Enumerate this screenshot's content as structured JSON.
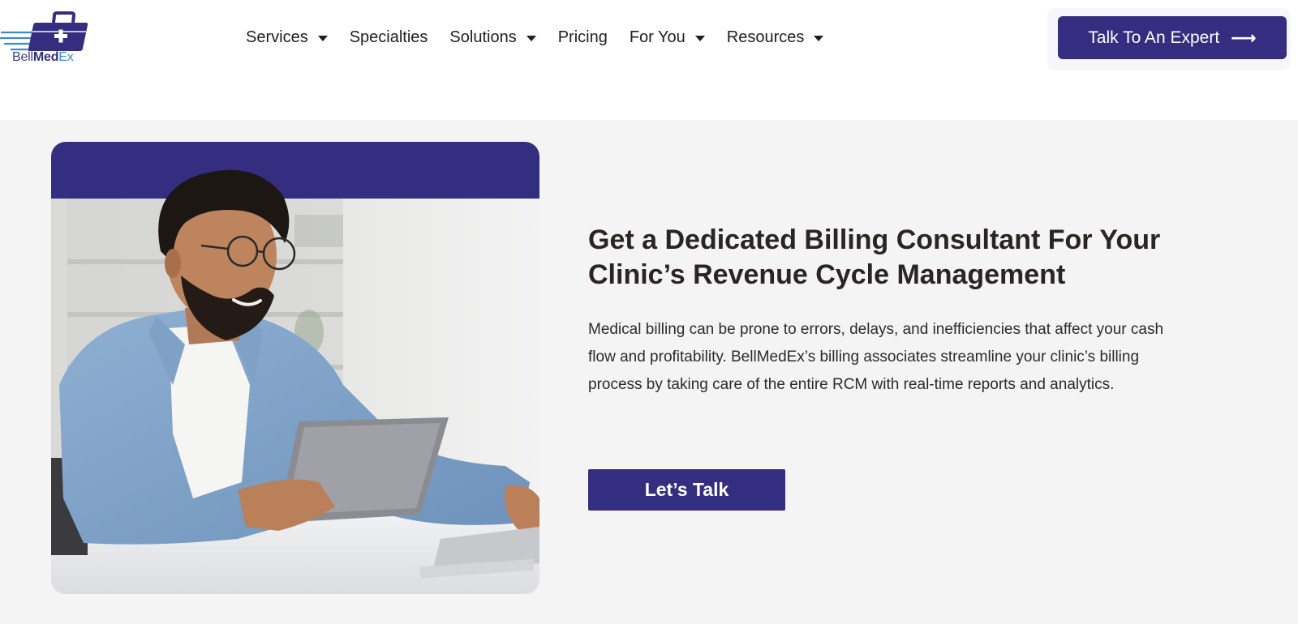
{
  "brand": {
    "logo_part1": "Bell",
    "logo_part2": "Med",
    "logo_part3": "Ex",
    "primary_color": "#352d7f",
    "accent_color": "#3f8ac8"
  },
  "nav": {
    "items": [
      {
        "label": "Services",
        "has_dropdown": true
      },
      {
        "label": "Specialties",
        "has_dropdown": false
      },
      {
        "label": "Solutions",
        "has_dropdown": true
      },
      {
        "label": "Pricing",
        "has_dropdown": false
      },
      {
        "label": "For You",
        "has_dropdown": true
      },
      {
        "label": "Resources",
        "has_dropdown": true
      }
    ],
    "dropdown_icon": "caret-down-icon"
  },
  "header_cta": {
    "label": "Talk To An Expert",
    "icon": "arrow-right-icon",
    "icon_glyph": "⟶"
  },
  "hero": {
    "headline": "Get a Dedicated Billing Consultant For Your Clinic’s Revenue Cycle Management",
    "body": "Medical billing can be prone to errors, delays, and inefficiencies that affect your cash flow and profitability. BellMedEx’s billing associates streamline your clinic’s billing process by taking care of the entire RCM with real-time reports and analytics.",
    "button_label": "Let’s Talk"
  }
}
